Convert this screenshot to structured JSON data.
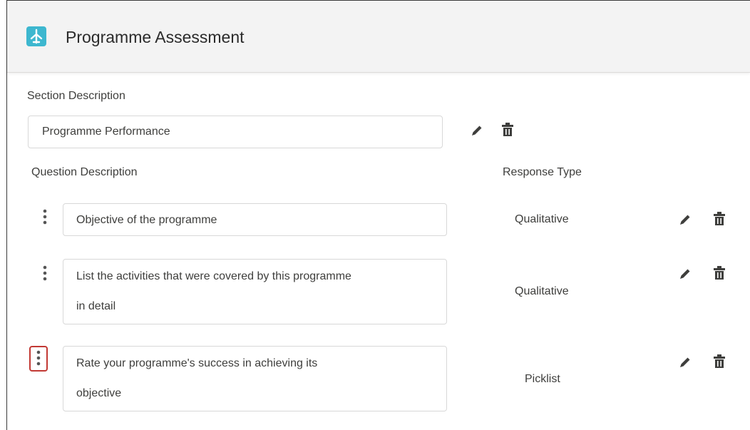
{
  "header": {
    "title": "Programme Assessment",
    "icon": "flight-icon"
  },
  "section": {
    "label": "Section Description",
    "value": "Programme Performance"
  },
  "columns": {
    "question": "Question Description",
    "response": "Response Type"
  },
  "questions": [
    {
      "text": "Objective of the programme",
      "response_type": "Qualitative"
    },
    {
      "line1": "List the activities that were covered by this programme",
      "line2": "in detail",
      "response_type": "Qualitative"
    },
    {
      "line1": "Rate your programme's success in achieving its",
      "line2": "objective",
      "response_type": "Picklist"
    }
  ],
  "colors": {
    "accent": "#3db7cf",
    "highlight": "#c23934",
    "icon": "#3e3e3c"
  }
}
